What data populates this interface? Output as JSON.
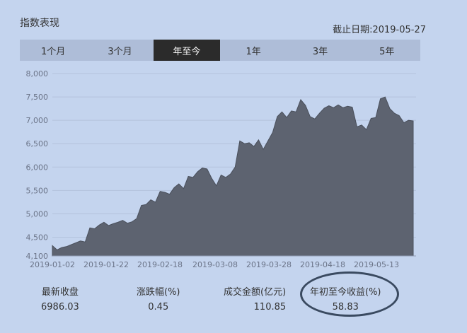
{
  "header": {
    "title": "指数表现",
    "as_of": "截止日期:2019-05-27"
  },
  "tabs": [
    {
      "label": "1个月",
      "active": false
    },
    {
      "label": "3个月",
      "active": false
    },
    {
      "label": "年至今",
      "active": true
    },
    {
      "label": "1年",
      "active": false
    },
    {
      "label": "3年",
      "active": false
    },
    {
      "label": "5年",
      "active": false
    }
  ],
  "chart_data": {
    "type": "area",
    "x_ticks": [
      "2019-01-02",
      "2019-01-22",
      "2019-02-18",
      "2019-03-08",
      "2019-03-28",
      "2019-04-18",
      "2019-05-13"
    ],
    "y_ticks": [
      "8,000",
      "7,500",
      "7,000",
      "6,500",
      "6,000",
      "5,500",
      "5,000",
      "4,500",
      "4,100"
    ],
    "ylim": [
      4100,
      8000
    ],
    "values": [
      4320,
      4230,
      4280,
      4300,
      4340,
      4380,
      4420,
      4400,
      4700,
      4680,
      4760,
      4820,
      4750,
      4790,
      4820,
      4860,
      4800,
      4830,
      4900,
      5180,
      5200,
      5300,
      5250,
      5480,
      5460,
      5420,
      5560,
      5640,
      5540,
      5800,
      5780,
      5900,
      5980,
      5960,
      5760,
      5600,
      5830,
      5780,
      5850,
      6000,
      6560,
      6500,
      6520,
      6440,
      6580,
      6380,
      6560,
      6740,
      7080,
      7180,
      7060,
      7200,
      7180,
      7440,
      7320,
      7080,
      7030,
      7150,
      7260,
      7310,
      7270,
      7330,
      7270,
      7300,
      7280,
      6860,
      6900,
      6800,
      7040,
      7060,
      7460,
      7500,
      7250,
      7150,
      7100,
      6950,
      7000,
      6986
    ],
    "fill_color": "#5d6370",
    "grid": true
  },
  "stats": {
    "latest_close": {
      "label": "最新收盘",
      "value": "6986.03"
    },
    "change_pct": {
      "label": "涨跌幅(%)",
      "value": "0.45"
    },
    "turnover": {
      "label": "成交金额(亿元)",
      "value": "110.85"
    },
    "ytd_return": {
      "label": "年初至今收益(%)",
      "value": "58.83"
    }
  }
}
